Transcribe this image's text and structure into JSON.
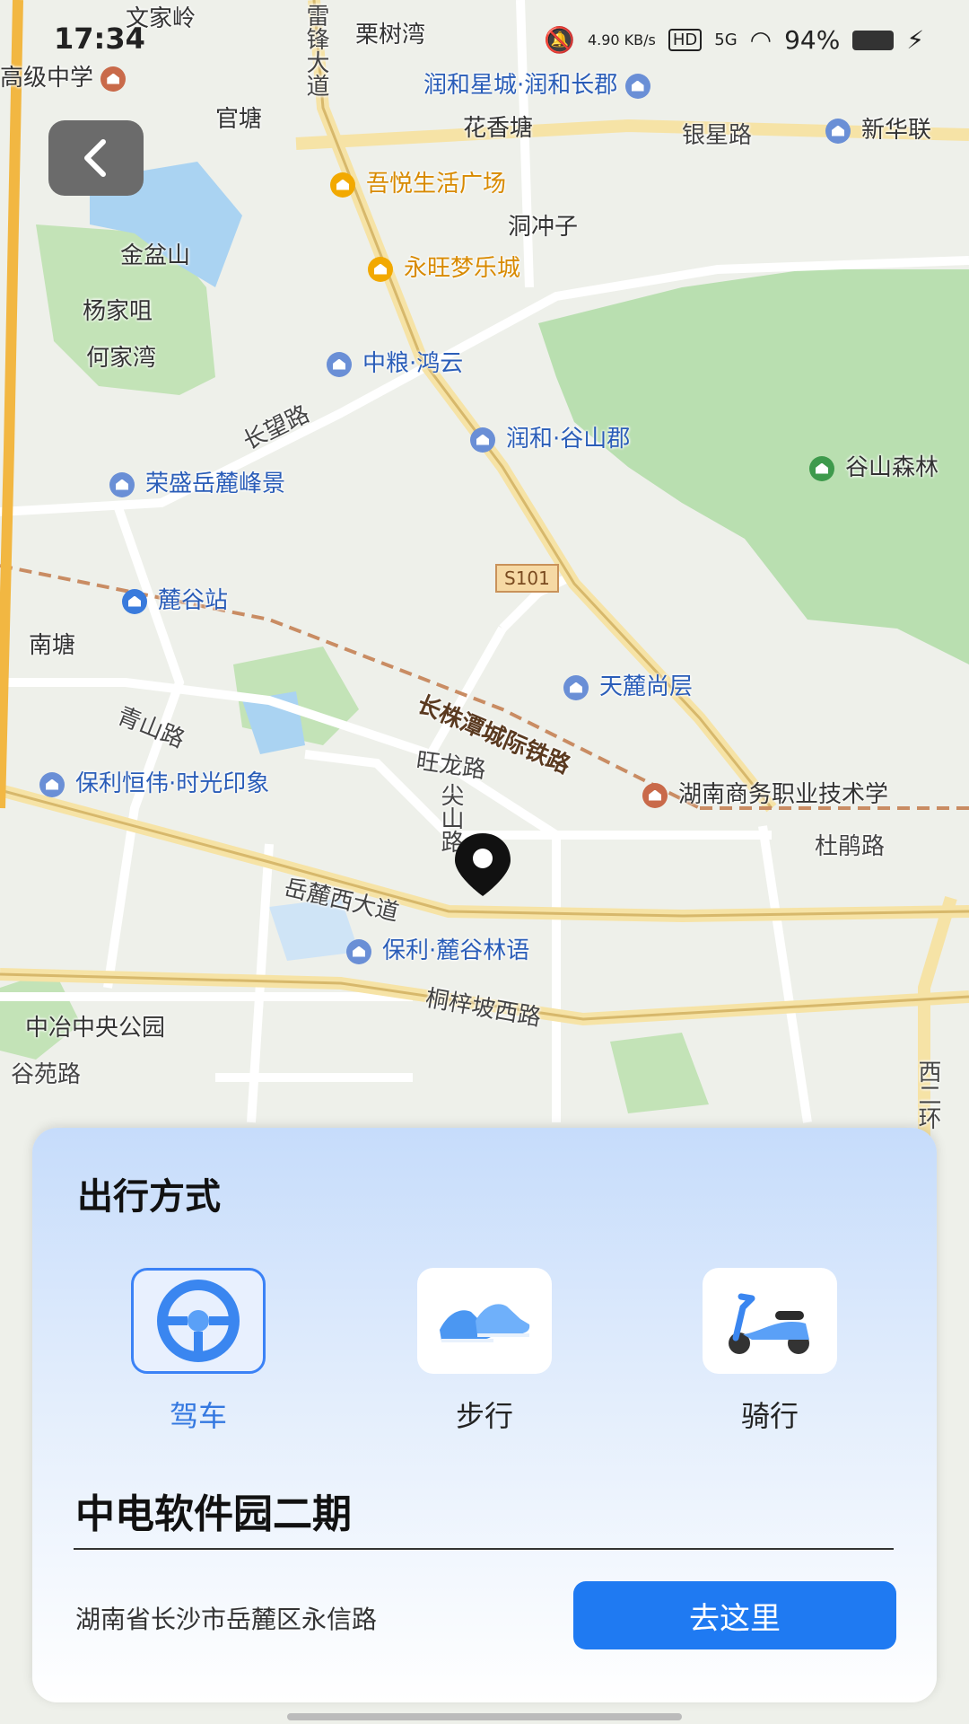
{
  "status_bar": {
    "time": "17:34",
    "net_speed": "4.90 KB/s",
    "network": "5G",
    "battery": "94%"
  },
  "map": {
    "labels": {
      "l1": "文家岭",
      "l2": "栗树湾",
      "l3": "高级中学",
      "l4": "润和星城·润和长郡",
      "l5": "官塘",
      "l6": "花香塘",
      "l7": "银星路",
      "l8": "新华联",
      "l9": "吾悦生活广场",
      "l10": "洞冲子",
      "l11": "金盆山",
      "l12": "永旺梦乐城",
      "l13": "杨家咀",
      "l14": "何家湾",
      "l15": "中粮·鸿云",
      "l16": "长望路",
      "l17": "润和·谷山郡",
      "l18": "谷山森林",
      "l19": "荣盛岳麓峰景",
      "l20": "S101",
      "l21": "麓谷站",
      "l22": "南塘",
      "l23": "天麓尚层",
      "l24": "青山路",
      "l25": "长株潭城际铁路",
      "l26": "旺龙路",
      "l27": "保利恒伟·时光印象",
      "l28": "尖山路",
      "l29": "湖南商务职业技术学",
      "l30": "杜鹃路",
      "l31": "岳麓西大道",
      "l32": "保利·麓谷林语",
      "l33": "桐梓坡西路",
      "l34": "中冶中央公园",
      "l35": "谷苑路",
      "l36": "西二环",
      "l37": "雷锋大道"
    }
  },
  "panel": {
    "title": "出行方式",
    "modes": [
      {
        "label": "驾车",
        "icon": "steering-wheel-icon"
      },
      {
        "label": "步行",
        "icon": "sneakers-icon"
      },
      {
        "label": "骑行",
        "icon": "scooter-icon"
      }
    ],
    "destination": "中电软件园二期",
    "address": "湖南省长沙市岳麓区永信路",
    "go_label": "去这里"
  }
}
